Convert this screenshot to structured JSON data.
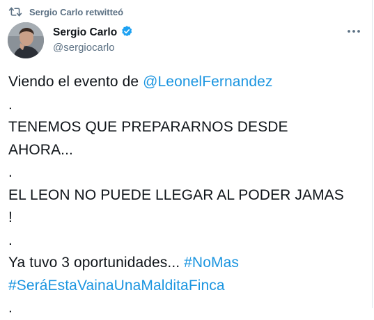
{
  "retweet": {
    "text": "Sergio Carlo retwitteó",
    "icon": "retweet-icon"
  },
  "author": {
    "name": "Sergio Carlo",
    "handle": "@sergiocarlo",
    "verified_icon": "verified-badge-icon",
    "avatar_icon": "avatar-photo"
  },
  "more_icon": "more-options-icon",
  "tweet": {
    "line1_text": "Viendo el evento de ",
    "line1_mention": "@LeonelFernandez",
    "dot1": ".",
    "line2": "TENEMOS QUE PREPARARNOS DESDE",
    "line3": "AHORA...",
    "dot2": ".",
    "line4": "EL LEON NO PUEDE LLEGAR AL PODER JAMAS",
    "line5": "!",
    "dot3": ".",
    "line6_text": "Ya tuvo 3 oportunidades... ",
    "line6_hashtag": "#NoMas",
    "line7_hashtag": "#SeráEstaVainaUnaMalditaFinca",
    "dot4": "."
  },
  "colors": {
    "link": "#1b95e0",
    "text": "#0f1419",
    "secondary": "#5b7083",
    "verified": "#1da1f2"
  }
}
